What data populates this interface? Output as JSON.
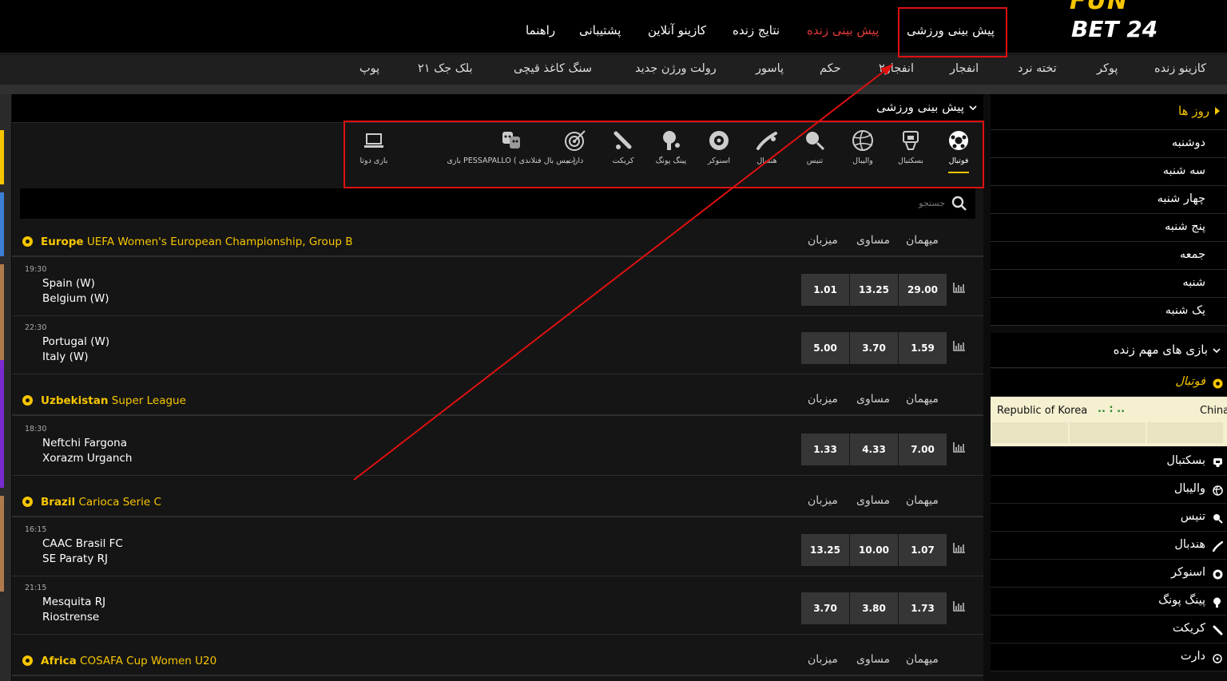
{
  "logo": {
    "line1": "FUN",
    "line2": "BET 24"
  },
  "topnav": [
    {
      "label": "پیش بینی ورزشی",
      "color": "white"
    },
    {
      "label": "پیش بینی زنده",
      "color": "red"
    },
    {
      "label": "نتایج زنده",
      "color": "white"
    },
    {
      "label": "کازینو آنلاین",
      "color": "white"
    },
    {
      "label": "پشتیبانی",
      "color": "white"
    },
    {
      "label": "راهنما",
      "color": "white"
    }
  ],
  "subnav": [
    "کازینو زنده",
    "پوکر",
    "تخته نرد",
    "انفجار",
    "انفجار۲",
    "حکم",
    "پاسور",
    "رولت ورژن جدید",
    "سنگ کاغذ قیچی",
    "بلک جک ۲۱",
    "پوپ"
  ],
  "main": {
    "title": "پیش بینی ورزشی",
    "search_placeholder": "جستجو",
    "sports": [
      {
        "label": "فوتبال",
        "icon": "soccer-icon",
        "active": true
      },
      {
        "label": "بسکتبال",
        "icon": "basketball-icon"
      },
      {
        "label": "والیبال",
        "icon": "volleyball-icon"
      },
      {
        "label": "تنیس",
        "icon": "tennis-icon"
      },
      {
        "label": "هندبال",
        "icon": "handball-icon"
      },
      {
        "label": "اسنوکر",
        "icon": "snooker-icon"
      },
      {
        "label": "پینگ پونگ",
        "icon": "ping-pong-icon"
      },
      {
        "label": "کریکت",
        "icon": "cricket-icon"
      },
      {
        "label": "دارت",
        "icon": "darts-icon"
      },
      {
        "label": "بازی PESSAPALLO ( بیس بال فنلاندی )",
        "icon": "pesapallo-icon"
      },
      {
        "label": "بازی دوتا",
        "icon": "dota-icon"
      }
    ],
    "odds_headers": {
      "home": "میزبان",
      "draw": "مساوی",
      "away": "میهمان"
    },
    "leagues": [
      {
        "region": "Europe",
        "name": "UEFA Women's European Championship, Group B",
        "matches": [
          {
            "time": "19:30",
            "home": "Spain (W)",
            "away": "Belgium (W)",
            "odds": [
              "1.01",
              "13.25",
              "29.00"
            ]
          },
          {
            "time": "22:30",
            "home": "Portugal (W)",
            "away": "Italy (W)",
            "odds": [
              "5.00",
              "3.70",
              "1.59"
            ]
          }
        ]
      },
      {
        "region": "Uzbekistan",
        "name": "Super League",
        "matches": [
          {
            "time": "18:30",
            "home": "Neftchi Fargona",
            "away": "Xorazm Urganch",
            "odds": [
              "1.33",
              "4.33",
              "7.00"
            ]
          }
        ]
      },
      {
        "region": "Brazil",
        "name": "Carioca Serie C",
        "matches": [
          {
            "time": "16:15",
            "home": "CAAC Brasil FC",
            "away": "SE Paraty RJ",
            "odds": [
              "13.25",
              "10.00",
              "1.07"
            ]
          },
          {
            "time": "21:15",
            "home": "Mesquita RJ",
            "away": "Riostrense",
            "odds": [
              "3.70",
              "3.80",
              "1.73"
            ]
          }
        ]
      },
      {
        "region": "Africa",
        "name": "COSAFA Cup Women U20",
        "matches": []
      }
    ]
  },
  "right": {
    "days_title": "روز ها",
    "days": [
      "دوشنبه",
      "سه شنبه",
      "چهار شنبه",
      "پنج شنبه",
      "جمعه",
      "شنبه",
      "یک شنبه"
    ],
    "important_title": "بازی های مهم زنده",
    "football_label": "فوتبال",
    "live_match": {
      "home": "Republic of Korea",
      "score": "..  :  ..",
      "away": "China"
    },
    "sports": [
      {
        "label": "بسکتبال",
        "icon": "basketball-icon"
      },
      {
        "label": "والیبال",
        "icon": "volleyball-icon"
      },
      {
        "label": "تنیس",
        "icon": "tennis-icon"
      },
      {
        "label": "هندبال",
        "icon": "handball-icon"
      },
      {
        "label": "اسنوکر",
        "icon": "snooker-icon"
      },
      {
        "label": "پینگ پونگ",
        "icon": "ping-pong-icon"
      },
      {
        "label": "کریکت",
        "icon": "cricket-icon"
      },
      {
        "label": "دارت",
        "icon": "darts-icon"
      }
    ]
  },
  "colors": {
    "accent": "#f7c600",
    "annotation": "#e01010",
    "live": "#e53a3a"
  }
}
